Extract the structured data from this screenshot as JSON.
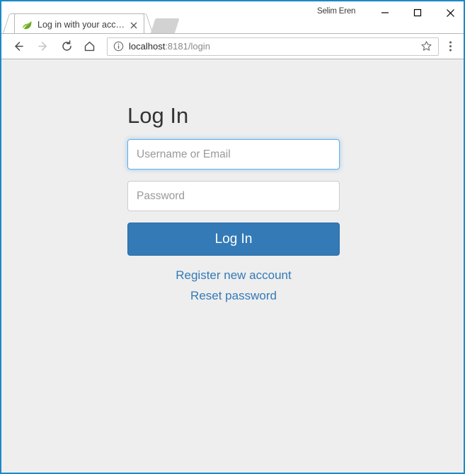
{
  "browser": {
    "profile_name": "Selim Eren",
    "window_controls": {
      "minimize": "minimize-icon",
      "maximize": "maximize-icon",
      "close": "close-icon"
    },
    "tab": {
      "title": "Log in with your account",
      "favicon": "spring-leaf-icon",
      "close_label": "close-tab-icon"
    },
    "new_tab_label": "new-tab-button",
    "toolbar": {
      "back": "back-arrow-icon",
      "forward": "forward-arrow-icon",
      "reload": "reload-icon",
      "home": "home-icon",
      "bookmark": "star-icon",
      "menu": "three-dot-menu-icon"
    },
    "omnibox": {
      "page_info_icon": "info-circle-icon",
      "url_host": "localhost",
      "url_path": ":8181/login",
      "full_url": "localhost:8181/login"
    }
  },
  "page": {
    "title": "Log In",
    "fields": [
      {
        "name": "username",
        "placeholder": "Username or Email",
        "value": "",
        "type": "text",
        "focused": true
      },
      {
        "name": "password",
        "placeholder": "Password",
        "value": "",
        "type": "password",
        "focused": false
      }
    ],
    "submit_label": "Log In",
    "links": [
      {
        "label": "Register new account"
      },
      {
        "label": "Reset password"
      }
    ],
    "colors": {
      "background": "#eeeeee",
      "primary": "#337ab7",
      "link": "#337ab7",
      "focus_border": "#66afe9",
      "window_border": "#1b8ac7",
      "heading": "#333333"
    }
  }
}
